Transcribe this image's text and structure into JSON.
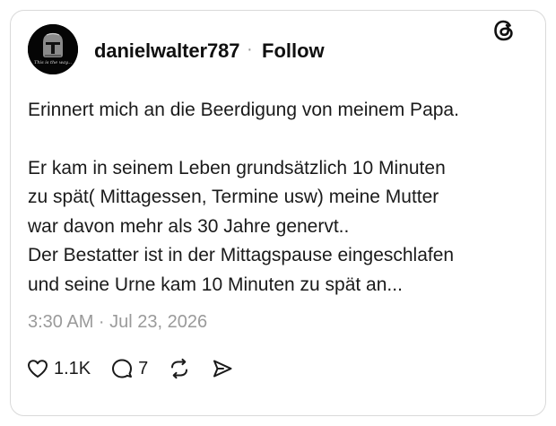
{
  "post": {
    "username": "danielwalter787",
    "separator": "·",
    "follow_label": "Follow",
    "avatar_caption": "This is the way...",
    "text_lines": [
      "Erinnert mich an die Beerdigung von meinem Papa.",
      "Er kam in seinem Leben grundsätzlich 10 Minuten",
      "zu spät( Mittagessen, Termine usw) meine Mutter",
      "war davon mehr als 30 Jahre genervt..",
      "Der Bestatter ist in der Mittagspause eingeschlafen",
      "und seine Urne kam 10 Minuten zu spät an..."
    ],
    "timestamp": "3:30 AM · Jul 23, 2026"
  },
  "actions": {
    "likes": "1.1K",
    "replies": "7"
  },
  "icons": {
    "brand": "threads-logo-icon",
    "like": "heart-icon",
    "reply": "comment-bubble-icon",
    "repost": "repost-icon",
    "share": "send-icon"
  },
  "colors": {
    "text": "#101010",
    "muted": "#9a9a9a",
    "border": "#d9d9d9"
  }
}
